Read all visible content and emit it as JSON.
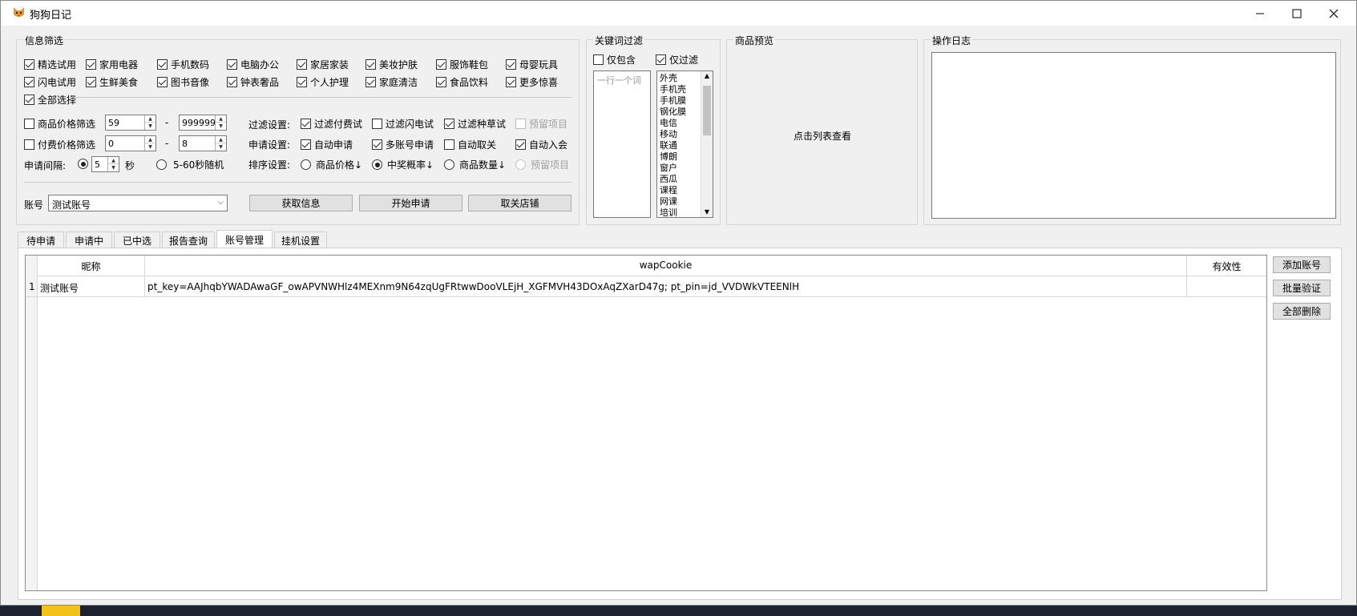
{
  "window": {
    "title": "狗狗日记"
  },
  "info_filter": {
    "title": "信息筛选",
    "categories": [
      {
        "label": "精选试用",
        "checked": true
      },
      {
        "label": "家用电器",
        "checked": true
      },
      {
        "label": "手机数码",
        "checked": true
      },
      {
        "label": "电脑办公",
        "checked": true
      },
      {
        "label": "家居家装",
        "checked": true
      },
      {
        "label": "美妆护肤",
        "checked": true
      },
      {
        "label": "服饰鞋包",
        "checked": true
      },
      {
        "label": "母婴玩具",
        "checked": true
      },
      {
        "label": "闪电试用",
        "checked": true
      },
      {
        "label": "生鲜美食",
        "checked": true
      },
      {
        "label": "图书音像",
        "checked": true
      },
      {
        "label": "钟表奢品",
        "checked": true
      },
      {
        "label": "个人护理",
        "checked": true
      },
      {
        "label": "家庭清洁",
        "checked": true
      },
      {
        "label": "食品饮料",
        "checked": true
      },
      {
        "label": "更多惊喜",
        "checked": true
      }
    ],
    "select_all": {
      "label": "全部选择",
      "checked": true
    },
    "price_filter": {
      "label": "商品价格筛选",
      "checked": false,
      "min": "59",
      "max": "999999"
    },
    "paid_price_filter": {
      "label": "付费价格筛选",
      "checked": false,
      "min": "0",
      "max": "8"
    },
    "range_sep": "-",
    "interval": {
      "label": "申请间隔:",
      "value": "5",
      "unit": "秒",
      "random_label": "5-60秒随机"
    },
    "filter_settings": {
      "label": "过滤设置:",
      "items": [
        {
          "label": "过滤付费试",
          "checked": true
        },
        {
          "label": "过滤闪电试",
          "checked": false
        },
        {
          "label": "过滤种草试",
          "checked": true
        },
        {
          "label": "预留项目",
          "checked": false
        }
      ]
    },
    "apply_settings": {
      "label": "申请设置:",
      "items": [
        {
          "label": "自动申请",
          "checked": true
        },
        {
          "label": "多账号申请",
          "checked": true
        },
        {
          "label": "自动取关",
          "checked": false
        },
        {
          "label": "自动入会",
          "checked": true
        }
      ]
    },
    "sort_settings": {
      "label": "排序设置:",
      "items": [
        {
          "label": "商品价格↓",
          "selected": false
        },
        {
          "label": "中奖概率↓",
          "selected": true
        },
        {
          "label": "商品数量↓",
          "selected": false
        },
        {
          "label": "预留项目",
          "selected": false
        }
      ]
    },
    "account": {
      "label": "账号",
      "value": "测试账号"
    },
    "buttons": {
      "fetch": "获取信息",
      "start": "开始申请",
      "unfollow": "取关店铺"
    }
  },
  "keyword_filter": {
    "title": "关键词过滤",
    "include_only": {
      "label": "仅包含",
      "checked": false
    },
    "filter_only": {
      "label": "仅过滤",
      "checked": true
    },
    "include_placeholder": "一行一个词",
    "filter_words": [
      "外壳",
      "手机壳",
      "手机膜",
      "钢化膜",
      "电信",
      "移动",
      "联通",
      "博朗",
      "窗户",
      "西瓜",
      "课程",
      "网课",
      "培训"
    ]
  },
  "preview": {
    "title": "商品预览",
    "hint": "点击列表查看"
  },
  "log": {
    "title": "操作日志"
  },
  "tabs": [
    "待申请",
    "申请中",
    "已中选",
    "报告查询",
    "账号管理",
    "挂机设置"
  ],
  "active_tab": "账号管理",
  "account_table": {
    "columns": [
      "昵称",
      "wapCookie",
      "有效性"
    ],
    "rows": [
      {
        "index": "1",
        "nickname": "测试账号",
        "cookie": "pt_key=AAJhqbYWADAwaGF_owAPVNWHlz4MEXnm9N64zqUgFRtwwDooVLEjH_XGFMVH43DOxAqZXarD47g; pt_pin=jd_VVDWkVTEENlH",
        "validity": ""
      }
    ]
  },
  "side_buttons": {
    "add": "添加账号",
    "verify": "批量验证",
    "delete_all": "全部删除"
  }
}
